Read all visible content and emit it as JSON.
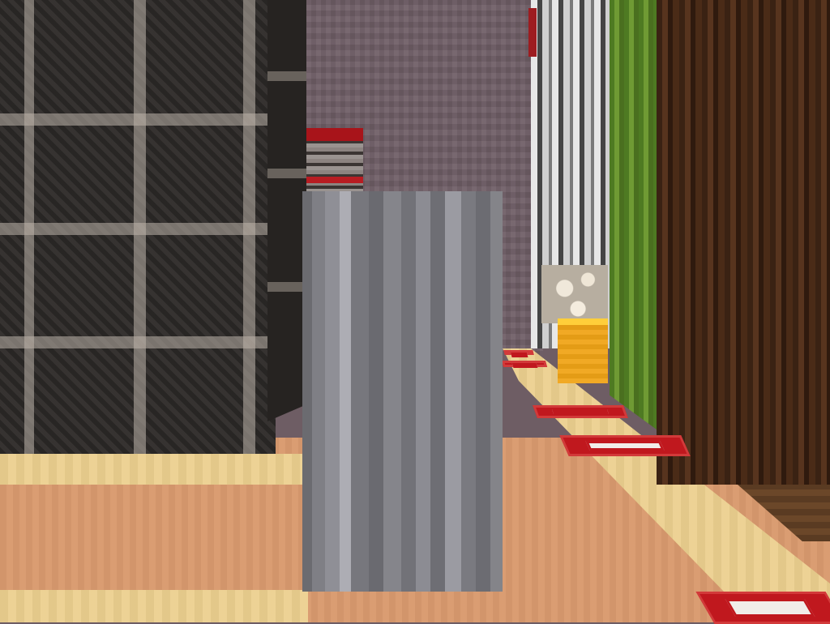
{
  "scene": {
    "type": "first-person voxel game view",
    "colors": {
      "sky_wall": "#6f5e66",
      "sand_floor": "#ecd08f",
      "terracotta_floor": "#d99a6e",
      "stone_pillar": "#85858b",
      "dark_tiles": "#2f2c2a",
      "redstone": "#c0181e",
      "gold": "#f0a417",
      "cactus": "#4e7a22",
      "wood": "#3a2213"
    },
    "objects": [
      "dark-tiled-tower",
      "stone-pillar",
      "red-stacked-block",
      "striped-quartz-column",
      "glowstone-block",
      "gold-block",
      "cactus-column",
      "dark-oak-wall",
      "redstone-plate"
    ]
  }
}
